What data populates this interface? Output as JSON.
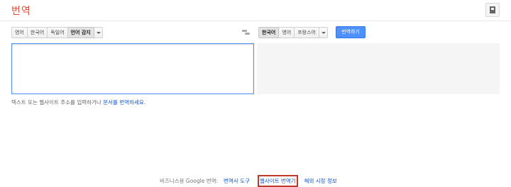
{
  "header": {
    "title": "번역"
  },
  "source_languages": {
    "buttons": [
      "영어",
      "한국어",
      "독일어",
      "언어 감지"
    ],
    "active_index": 3
  },
  "target_languages": {
    "buttons": [
      "한국어",
      "영어",
      "프랑스어"
    ],
    "active_index": 0
  },
  "translate_button": "번역하기",
  "source_input": {
    "value": ""
  },
  "hint": {
    "text": "텍스트 또는 웹사이트 주소를 입력하거나 ",
    "link": "문서를 번역하세요",
    "suffix": "."
  },
  "footer": {
    "label": "비즈니스용 Google 번역:",
    "links": [
      "번역사 도구",
      "웹사이트 번역기",
      "해외 시장 정보"
    ]
  },
  "colors": {
    "title": "#dd4b39",
    "primary_button": "#4d90fe",
    "link": "#1155cc",
    "highlight_box": "#c0392b"
  }
}
